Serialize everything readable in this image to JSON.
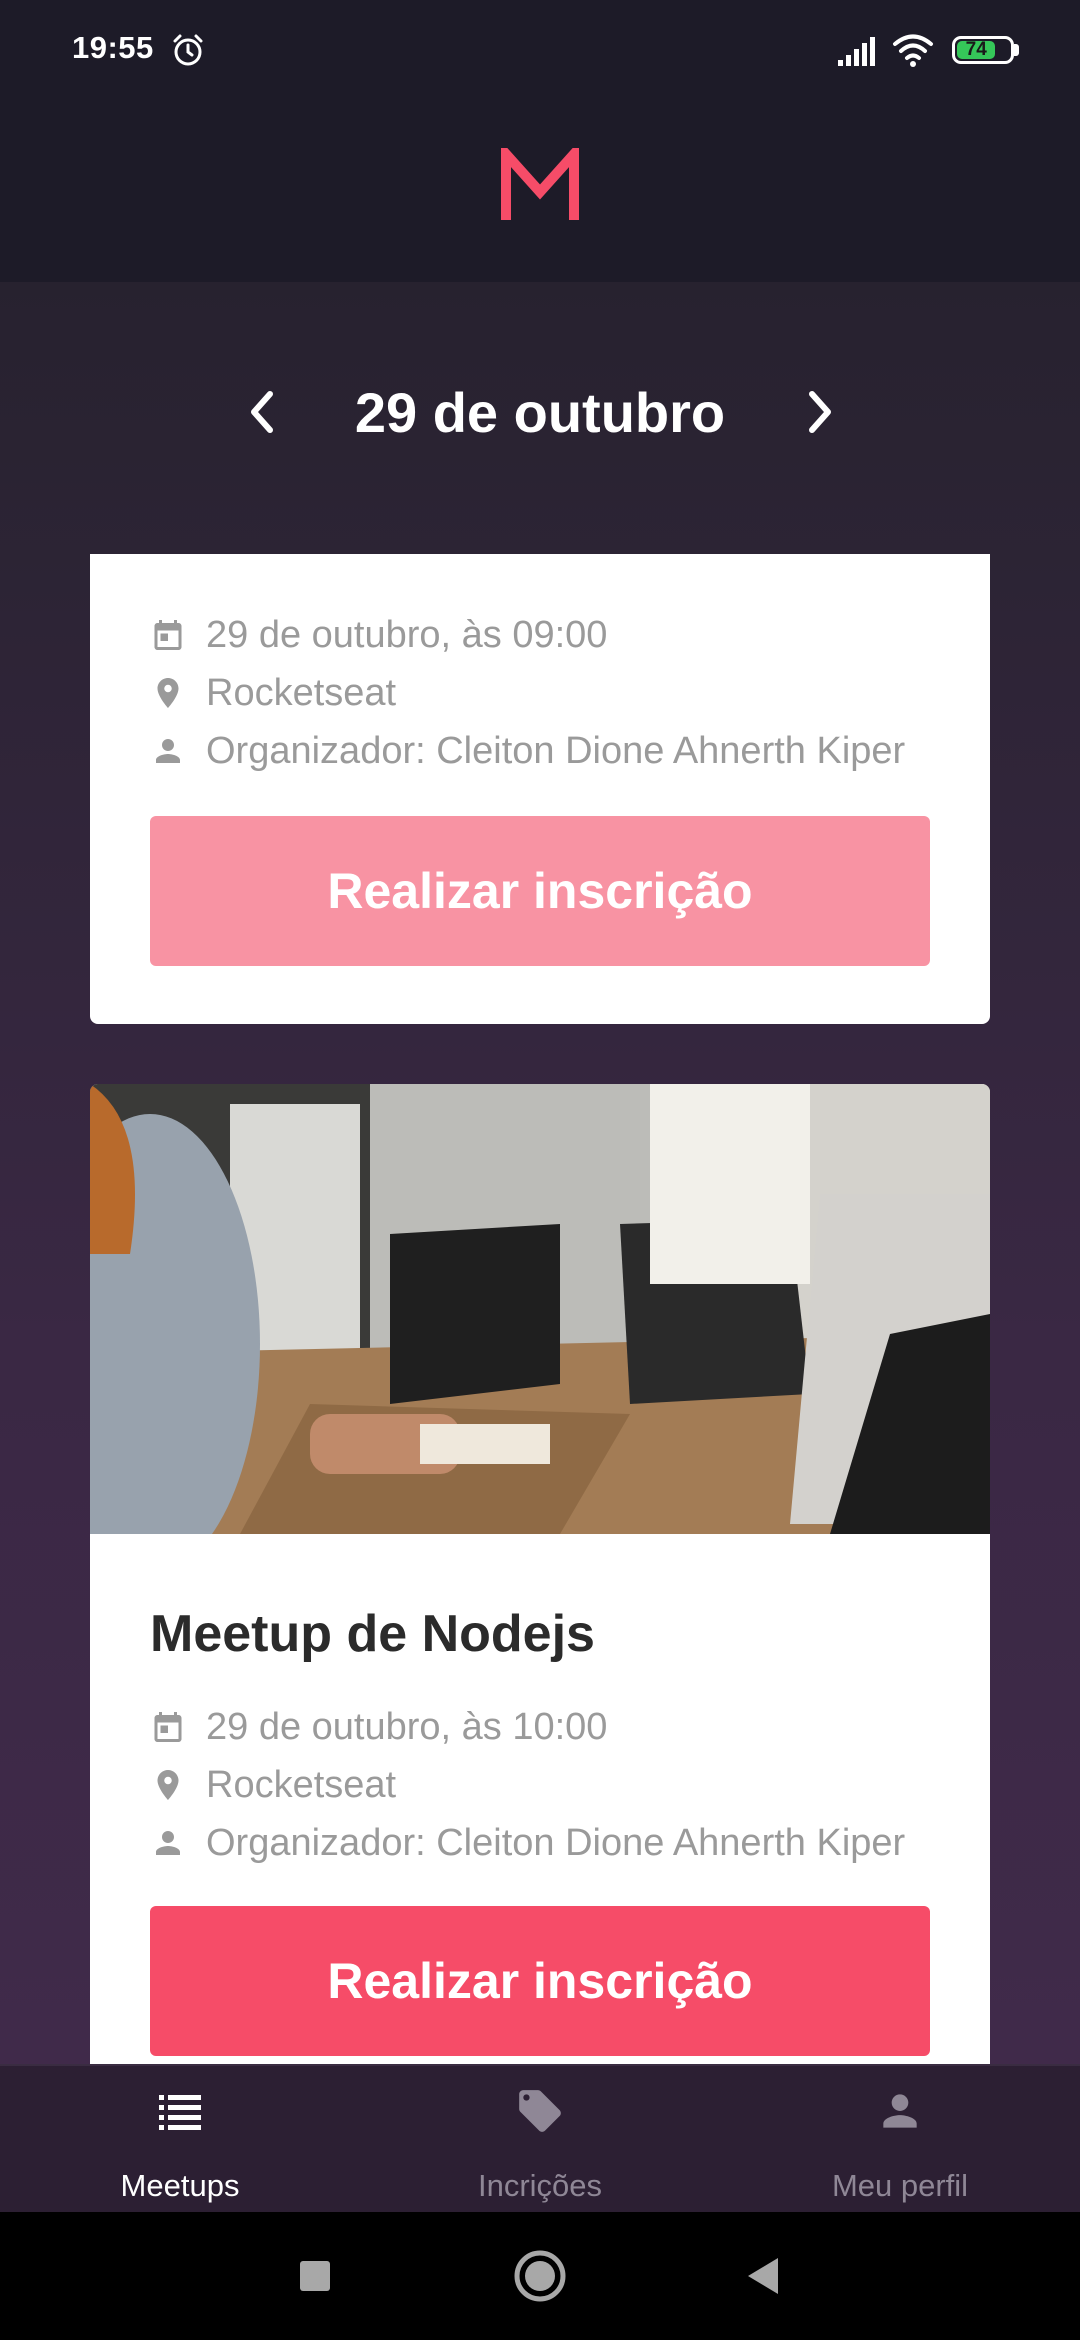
{
  "status_bar": {
    "time": "19:55",
    "battery_level": "74",
    "icons": [
      "alarm-icon",
      "signal-icon",
      "wifi-icon",
      "battery-icon"
    ]
  },
  "header": {
    "logo_letter": "M",
    "logo_color": "#f64c68"
  },
  "date_nav": {
    "date_label": "29 de outubro",
    "prev_icon": "chevron-left-icon",
    "next_icon": "chevron-right-icon"
  },
  "meetups": [
    {
      "title": "",
      "date": "29 de outubro, às 09:00",
      "location": "Rocketseat",
      "organizer": "Organizador: Cleiton Dione Ahnerth Kiper",
      "button_label": "Realizar inscrição",
      "button_state": "disabled"
    },
    {
      "title": "Meetup de Nodejs",
      "image": "office-laptops-photo",
      "date": "29 de outubro, às 10:00",
      "location": "Rocketseat",
      "organizer": "Organizador: Cleiton Dione Ahnerth Kiper",
      "button_label": "Realizar inscrição",
      "button_state": "enabled"
    }
  ],
  "tabs": [
    {
      "label": "Meetups",
      "icon": "list-icon",
      "active": true
    },
    {
      "label": "Incrições",
      "icon": "tag-icon",
      "active": false
    },
    {
      "label": "Meu perfil",
      "icon": "person-icon",
      "active": false
    }
  ],
  "colors": {
    "accent": "#f64c68",
    "accent_faded": "#f893a3",
    "header_bg": "#1d1b28",
    "tabbar_bg": "#2c1f33"
  }
}
